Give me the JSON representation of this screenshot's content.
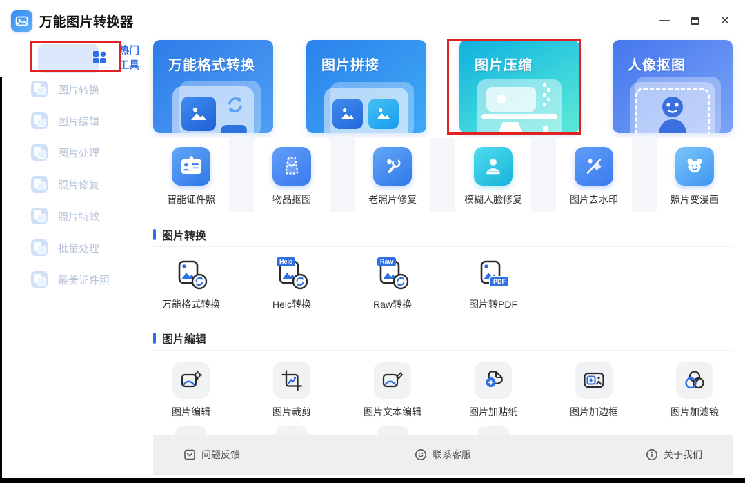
{
  "window": {
    "title": "万能图片转换器"
  },
  "sidebar": {
    "items": [
      {
        "label": "热门工具",
        "active": true
      },
      {
        "label": "图片转换",
        "active": false
      },
      {
        "label": "图片编辑",
        "active": false
      },
      {
        "label": "图片处理",
        "active": false
      },
      {
        "label": "照片修复",
        "active": false
      },
      {
        "label": "照片特效",
        "active": false
      },
      {
        "label": "批量处理",
        "active": false
      },
      {
        "label": "最美证件照",
        "active": false
      }
    ]
  },
  "banners": [
    {
      "label": "万能格式转换",
      "highlighted": false
    },
    {
      "label": "图片拼接",
      "highlighted": false
    },
    {
      "label": "图片压缩",
      "highlighted": true
    },
    {
      "label": "人像抠图",
      "highlighted": false
    }
  ],
  "quick_tools": [
    {
      "label": "智能证件照"
    },
    {
      "label": "物品抠图"
    },
    {
      "label": "老照片修复"
    },
    {
      "label": "模糊人脸修复"
    },
    {
      "label": "图片去水印"
    },
    {
      "label": "照片变漫画"
    }
  ],
  "sections": [
    {
      "title": "图片转换",
      "tools": [
        {
          "label": "万能格式转换",
          "badge": ""
        },
        {
          "label": "Heic转换",
          "badge": "Heic"
        },
        {
          "label": "Raw转换",
          "badge": "Raw"
        },
        {
          "label": "图片转PDF",
          "badge": "PDF"
        }
      ]
    },
    {
      "title": "图片编辑",
      "tools": [
        {
          "label": "图片编辑"
        },
        {
          "label": "图片裁剪"
        },
        {
          "label": "图片文本编辑"
        },
        {
          "label": "图片加贴纸"
        },
        {
          "label": "图片加边框"
        },
        {
          "label": "图片加滤镜"
        }
      ]
    }
  ],
  "footer": {
    "items": [
      {
        "label": "问题反馈"
      },
      {
        "label": "联系客服"
      },
      {
        "label": "关于我们"
      }
    ]
  },
  "colors": {
    "accent": "#2f6fe4",
    "annotation_red": "#e02222",
    "banner_compress_gradient": [
      "#0fb0de",
      "#5ce8d5"
    ],
    "banner_blue_gradient": [
      "#2e7ce8",
      "#4f9ef4"
    ]
  }
}
